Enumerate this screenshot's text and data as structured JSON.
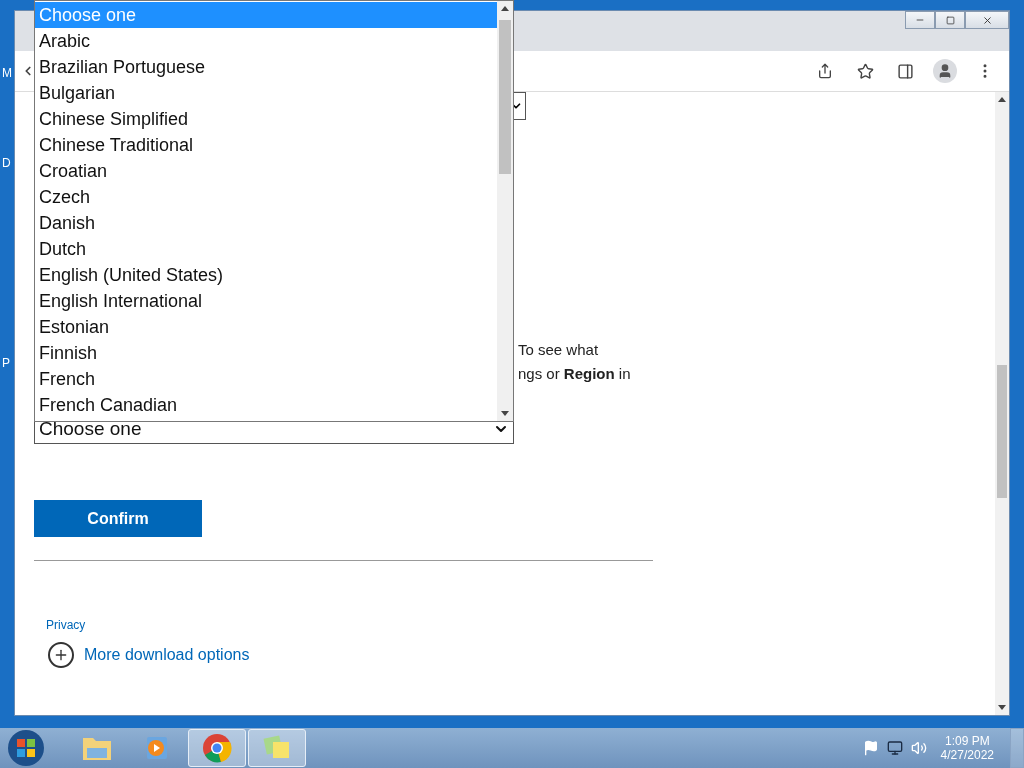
{
  "desktop": {
    "icon_labels": [
      "M",
      "D",
      "P"
    ]
  },
  "page": {
    "paragraph": [
      "To see what",
      "ngs or **Region** in"
    ],
    "language_select": {
      "value": "Choose one"
    },
    "confirm_button": "Confirm",
    "privacy_link": "Privacy",
    "more_options_link": "More download options"
  },
  "dropdown": {
    "options": [
      {
        "label": "Choose one",
        "selected": true
      },
      {
        "label": "Arabic",
        "selected": false
      },
      {
        "label": "Brazilian Portuguese",
        "selected": false
      },
      {
        "label": "Bulgarian",
        "selected": false
      },
      {
        "label": "Chinese Simplified",
        "selected": false
      },
      {
        "label": "Chinese Traditional",
        "selected": false
      },
      {
        "label": "Croatian",
        "selected": false
      },
      {
        "label": "Czech",
        "selected": false
      },
      {
        "label": "Danish",
        "selected": false
      },
      {
        "label": "Dutch",
        "selected": false
      },
      {
        "label": "English (United States)",
        "selected": false
      },
      {
        "label": "English International",
        "selected": false
      },
      {
        "label": "Estonian",
        "selected": false
      },
      {
        "label": "Finnish",
        "selected": false
      },
      {
        "label": "French",
        "selected": false
      },
      {
        "label": "French Canadian",
        "selected": false
      }
    ]
  },
  "taskbar": {
    "apps": [
      {
        "kind": "explorer",
        "active": false
      },
      {
        "kind": "media",
        "active": false
      },
      {
        "kind": "chrome",
        "active": true
      },
      {
        "kind": "notes",
        "active": true
      }
    ],
    "time": "1:09 PM",
    "date": "4/27/2022"
  }
}
